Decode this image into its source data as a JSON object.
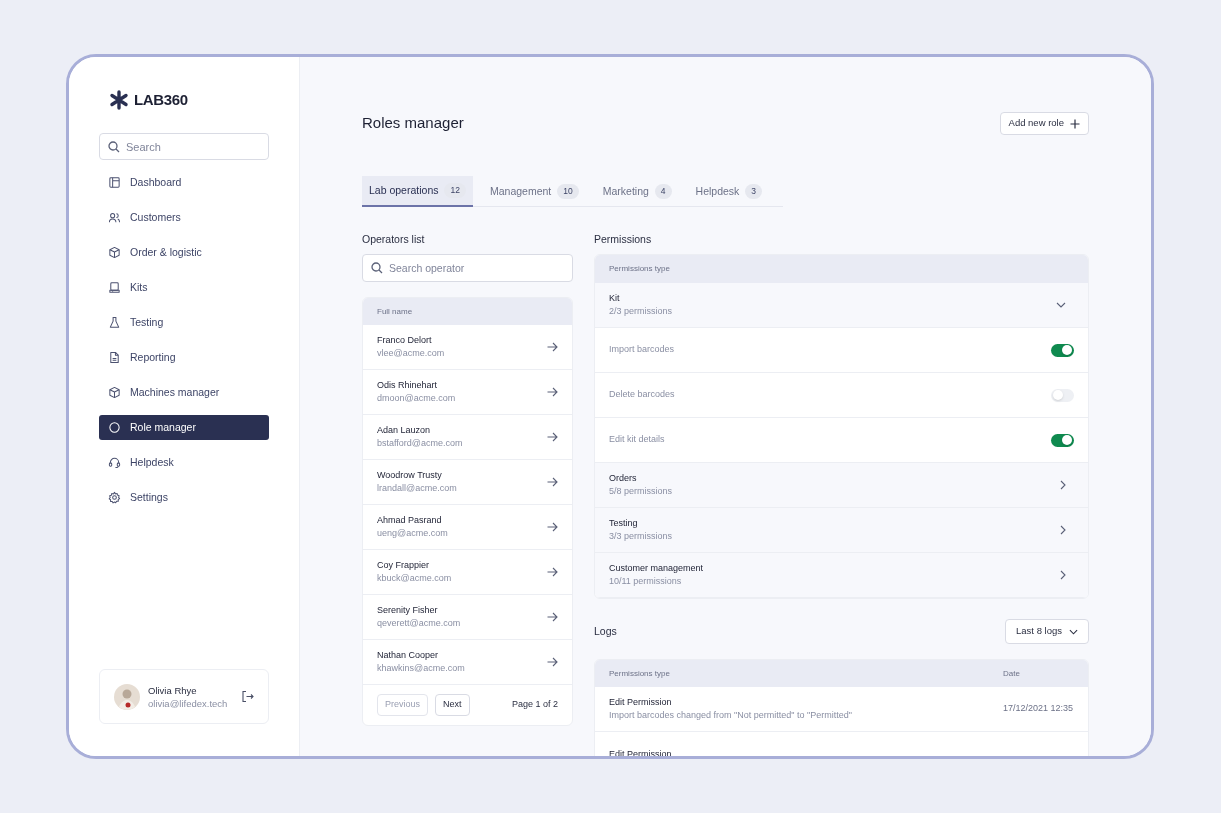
{
  "brand": {
    "logo": "LAB360"
  },
  "sidebar": {
    "search": {
      "placeholder": "Search"
    },
    "items": [
      {
        "label": "Dashboard",
        "selected": false
      },
      {
        "label": "Customers",
        "selected": false
      },
      {
        "label": "Order & logistic",
        "selected": false
      },
      {
        "label": "Kits",
        "selected": false
      },
      {
        "label": "Testing",
        "selected": false
      },
      {
        "label": "Reporting",
        "selected": false
      },
      {
        "label": "Machines manager",
        "selected": false
      },
      {
        "label": "Role manager",
        "selected": true
      },
      {
        "label": "Helpdesk",
        "selected": false
      },
      {
        "label": "Settings",
        "selected": false
      }
    ],
    "user": {
      "name": "Olivia Rhye",
      "email": "olivia@lifedex.tech"
    }
  },
  "header": {
    "title": "Roles manager",
    "add_button": "Add new role"
  },
  "tabs": [
    {
      "label": "Lab operations",
      "count": "12",
      "selected": true
    },
    {
      "label": "Management",
      "count": "10",
      "selected": false
    },
    {
      "label": "Marketing",
      "count": "4",
      "selected": false
    },
    {
      "label": "Helpdesk",
      "count": "3",
      "selected": false
    }
  ],
  "operators": {
    "title": "Operators list",
    "search": {
      "placeholder": "Search operator"
    },
    "column": "Full name",
    "rows": [
      {
        "name": "Franco Delort",
        "email": "vlee@acme.com"
      },
      {
        "name": "Odis Rhinehart",
        "email": "dmoon@acme.com"
      },
      {
        "name": "Adan Lauzon",
        "email": "bstafford@acme.com"
      },
      {
        "name": "Woodrow Trusty",
        "email": "lrandall@acme.com"
      },
      {
        "name": "Ahmad Pasrand",
        "email": "ueng@acme.com"
      },
      {
        "name": "Coy Frappier",
        "email": "kbuck@acme.com"
      },
      {
        "name": "Serenity Fisher",
        "email": "qeverett@acme.com"
      },
      {
        "name": "Nathan Cooper",
        "email": "khawkins@acme.com"
      }
    ],
    "pagination": {
      "previous": {
        "label": "Previous",
        "disabled": true
      },
      "next": {
        "label": "Next",
        "disabled": false
      },
      "page": "Page 1 of 2"
    }
  },
  "permissions": {
    "title": "Permissions",
    "column": "Permissions type",
    "groups": [
      {
        "name": "Kit",
        "summary": "2/3 permissions",
        "expanded": true,
        "items": [
          {
            "label": "Import barcodes",
            "on": true
          },
          {
            "label": "Delete barcodes",
            "on": false
          },
          {
            "label": "Edit kit details",
            "on": true
          }
        ]
      },
      {
        "name": "Orders",
        "summary": "5/8 permissions",
        "expanded": false
      },
      {
        "name": "Testing",
        "summary": "3/3 permissions",
        "expanded": false
      },
      {
        "name": "Customer management",
        "summary": "10/11 permissions",
        "expanded": false
      }
    ]
  },
  "logs": {
    "title": "Logs",
    "filter": "Last 8 logs",
    "columns": [
      "Permissions type",
      "Date"
    ],
    "rows": [
      {
        "title": "Edit Permission",
        "detail": "Import barcodes changed from \"Not permitted\" to \"Permitted\"",
        "date": "17/12/2021 12:35"
      },
      {
        "title": "Edit Permission"
      }
    ]
  }
}
